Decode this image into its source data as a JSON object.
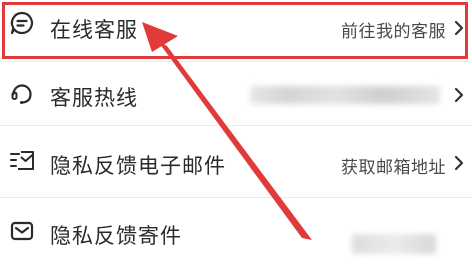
{
  "menu": {
    "items": [
      {
        "icon": "chat-bubble-icon",
        "label": "在线客服",
        "value": "前往我的客服"
      },
      {
        "icon": "headset-icon",
        "label": "客服热线",
        "value": ""
      },
      {
        "icon": "envelope-lines-icon",
        "label": "隐私反馈电子邮件",
        "value": "获取邮箱地址"
      },
      {
        "icon": "mail-icon",
        "label": "隐私反馈寄件",
        "value": ""
      }
    ]
  },
  "annotation": {
    "highlight_color": "#e03a3a",
    "arrow_color": "#e03a3a"
  }
}
